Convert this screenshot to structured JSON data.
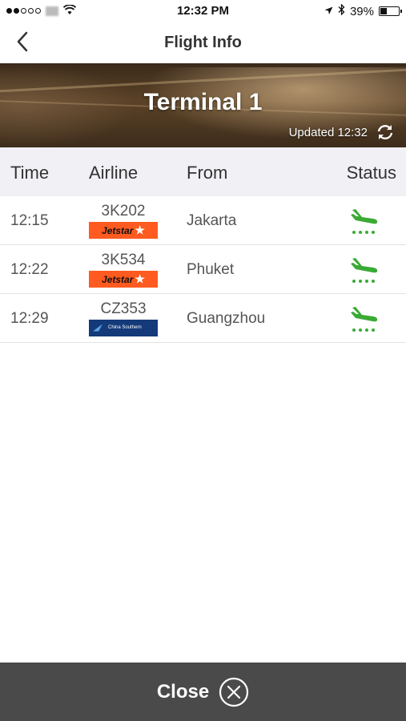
{
  "status_bar": {
    "time": "12:32 PM",
    "battery": "39%",
    "battery_level": 0.39
  },
  "nav": {
    "title": "Flight Info"
  },
  "banner": {
    "title": "Terminal 1",
    "updated": "Updated 12:32"
  },
  "table": {
    "headers": {
      "time": "Time",
      "airline": "Airline",
      "from": "From",
      "status": "Status"
    },
    "rows": [
      {
        "time": "12:15",
        "flight": "3K202",
        "airline_logo": "Jetstar",
        "from": "Jakarta",
        "status_icon": "plane-landing-icon"
      },
      {
        "time": "12:22",
        "flight": "3K534",
        "airline_logo": "Jetstar",
        "from": "Phuket",
        "status_icon": "plane-landing-icon"
      },
      {
        "time": "12:29",
        "flight": "CZ353",
        "airline_logo": "China Southern",
        "from": "Guangzhou",
        "status_icon": "plane-landing-icon"
      }
    ]
  },
  "footer": {
    "close_label": "Close"
  },
  "colors": {
    "status_green": "#3aaa35",
    "jetstar_orange": "#ff5a1f",
    "csa_blue": "#143a7a",
    "close_bar": "#4a4a4a"
  }
}
